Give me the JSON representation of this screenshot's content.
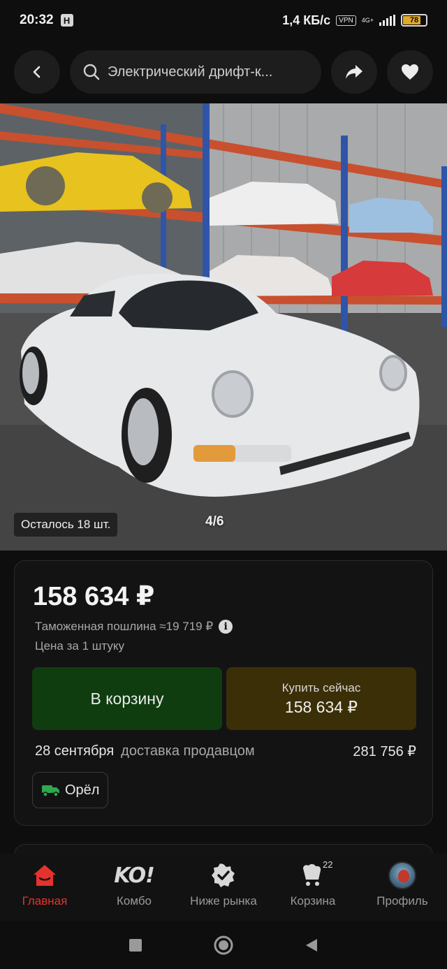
{
  "status_bar": {
    "time": "20:32",
    "notification_glyph": "H",
    "network_speed": "1,4 КБ/с",
    "vpn": "VPN",
    "network_type": "4G+",
    "battery": "78",
    "battery_level": 0.78,
    "battery_color": "#e0a92a"
  },
  "search": {
    "query": "Электрический дрифт-к..."
  },
  "top_bar": {
    "icons": [
      "back-arrow-icon",
      "search-icon",
      "share-icon",
      "heart-icon"
    ]
  },
  "gallery": {
    "stock": "Осталось 18 шт.",
    "page": "4/6"
  },
  "product": {
    "price": "158 634 ₽",
    "customs_duty": "Таможенная пошлина ≈19 719 ₽",
    "unit_price": "Цена за 1 штуку",
    "add_to_cart": "В корзину",
    "buy_now_label": "Купить сейчас",
    "buy_now_price": "158 634 ₽",
    "delivery_date": "28 сентября",
    "delivery_method": "доставка продавцом",
    "delivery_price": "281 756 ₽",
    "city": "Орёл"
  },
  "bottom_nav": {
    "items": [
      {
        "label": "Главная",
        "icon": "home-icon",
        "active": true
      },
      {
        "label": "Комбо",
        "icon": "ko-logo",
        "logo_text": "KO!"
      },
      {
        "label": "Ниже рынка",
        "icon": "check-badge-icon"
      },
      {
        "label": "Корзина",
        "icon": "cart-icon",
        "badge": "22"
      },
      {
        "label": "Профиль",
        "icon": "avatar"
      }
    ]
  },
  "colors": {
    "accent_red": "#e5322d",
    "cart_button": "#0f3d0f",
    "buy_button": "#3b2f08",
    "background": "#0e0e0e",
    "card": "#131313"
  }
}
